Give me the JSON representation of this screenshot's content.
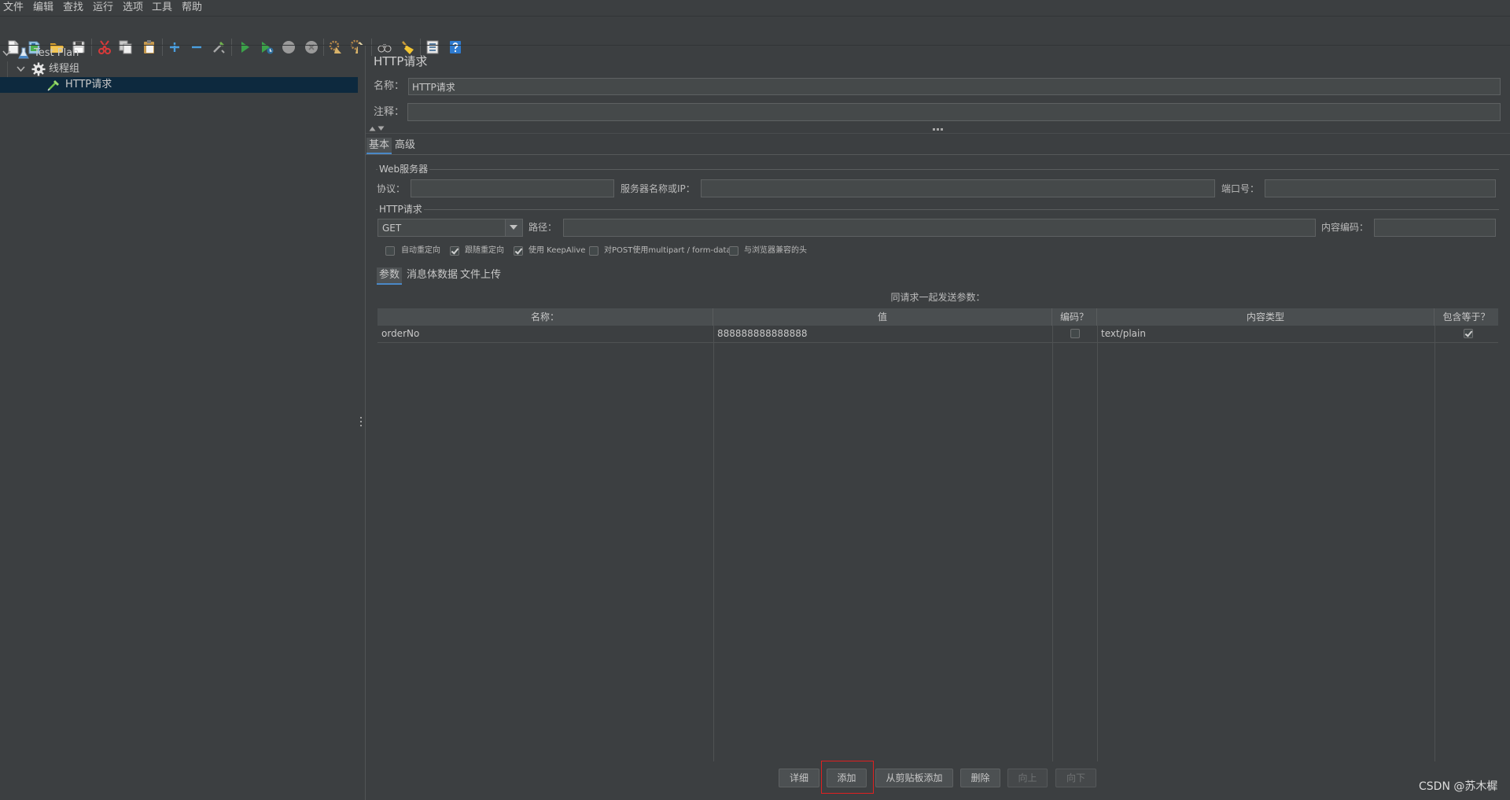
{
  "menu": {
    "items": [
      "文件",
      "编辑",
      "查找",
      "运行",
      "选项",
      "工具",
      "帮助"
    ]
  },
  "toolbar": {
    "icons": [
      "new-file-icon",
      "templates-icon",
      "open-icon",
      "save-icon",
      "cut-icon",
      "copy-icon",
      "paste-icon",
      "expand-all-icon",
      "collapse-all-icon",
      "toggle-icon",
      "start-icon",
      "start-no-pauses-icon",
      "stop-icon",
      "shutdown-icon",
      "clear-icon",
      "clear-all-icon",
      "search-icon",
      "reset-search-icon",
      "function-helper-icon",
      "help-icon"
    ]
  },
  "tree": {
    "items": [
      {
        "label": "Test Plan",
        "icon": "flask-icon",
        "selected": false
      },
      {
        "label": "线程组",
        "icon": "gear-icon",
        "selected": false
      },
      {
        "label": "HTTP请求",
        "icon": "pipette-icon",
        "selected": true
      }
    ]
  },
  "panel": {
    "title": "HTTP请求",
    "name_label": "名称：",
    "name_value": "HTTP请求",
    "comment_label": "注释：",
    "comment_value": ""
  },
  "tabs": {
    "items": [
      "基本",
      "高级"
    ],
    "selected": 0
  },
  "web_server": {
    "legend": "Web服务器",
    "protocol_label": "协议：",
    "protocol_value": "",
    "server_label": "服务器名称或IP：",
    "server_value": "",
    "port_label": "端口号：",
    "port_value": ""
  },
  "http_request": {
    "legend": "HTTP请求",
    "method": "GET",
    "path_label": "路径：",
    "path_value": "",
    "encoding_label": "内容编码：",
    "encoding_value": "",
    "options": [
      {
        "label": "自动重定向",
        "checked": false
      },
      {
        "label": "跟随重定向",
        "checked": true
      },
      {
        "label": "使用 KeepAlive",
        "checked": true
      },
      {
        "label": "对POST使用multipart / form-data",
        "checked": false
      },
      {
        "label": "与浏览器兼容的头",
        "checked": false
      }
    ]
  },
  "sub_tabs": {
    "items": [
      "参数",
      "消息体数据",
      "文件上传"
    ],
    "selected": 0
  },
  "params": {
    "caption": "同请求一起发送参数：",
    "columns": [
      "名称：",
      "值",
      "编码？",
      "内容类型",
      "包含等于？"
    ],
    "rows": [
      {
        "name": "orderNo",
        "value": "888888888888888",
        "encode": false,
        "content_type": "text/plain",
        "include_equals": true
      }
    ]
  },
  "buttons": [
    {
      "label": "详细",
      "enabled": true
    },
    {
      "label": "添加",
      "enabled": true,
      "highlighted": true
    },
    {
      "label": "从剪贴板添加",
      "enabled": true
    },
    {
      "label": "删除",
      "enabled": true
    },
    {
      "label": "向上",
      "enabled": false
    },
    {
      "label": "向下",
      "enabled": false
    }
  ],
  "watermark": "CSDN @苏木樨",
  "colors": {
    "background": "#3c3f41",
    "selection": "#0d293e",
    "accent": "#4a88c7",
    "highlight_box": "#e02020",
    "run_green": "#3ca24a"
  }
}
